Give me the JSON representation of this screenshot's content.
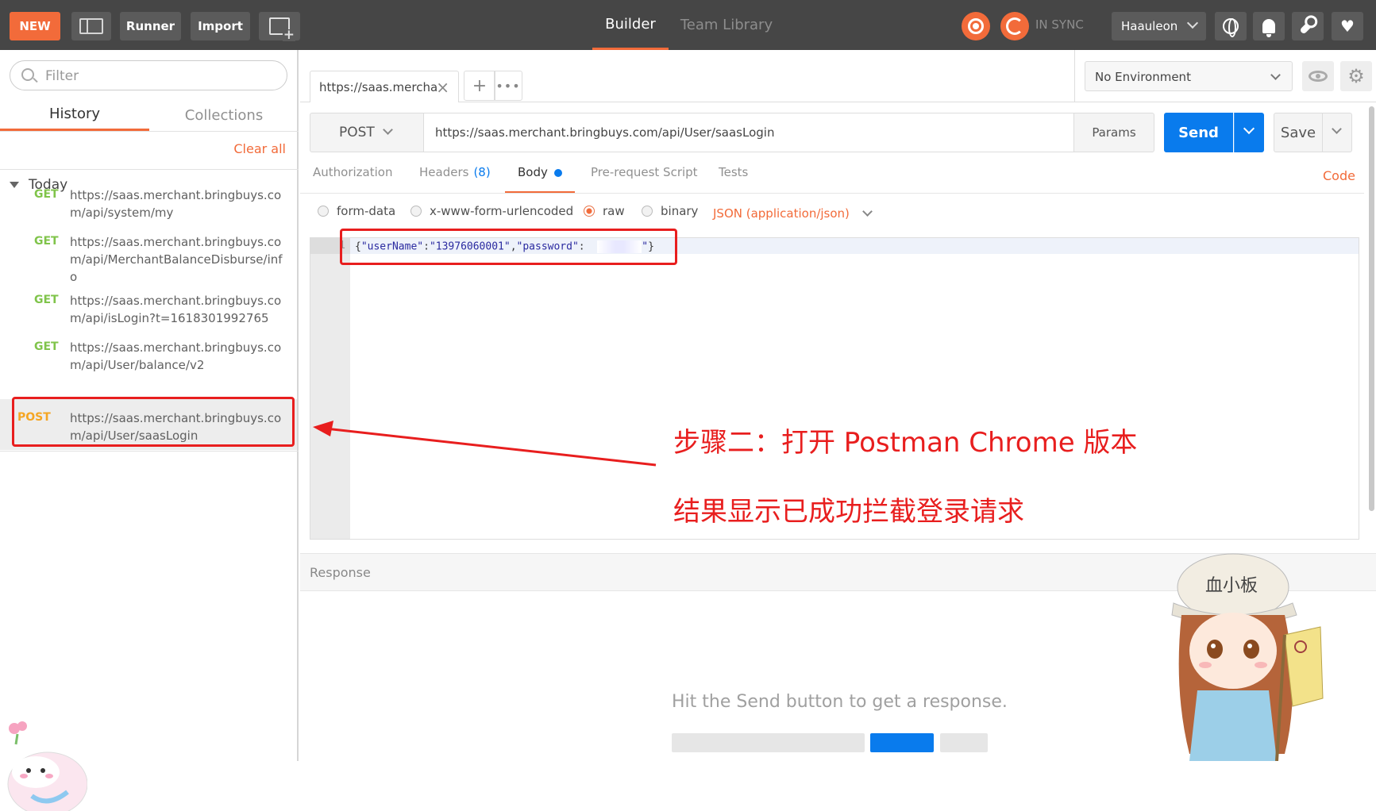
{
  "topbar": {
    "new_label": "NEW",
    "runner_label": "Runner",
    "import_label": "Import",
    "builder_label": "Builder",
    "team_library_label": "Team Library",
    "sync_label": "IN SYNC",
    "user_name": "Haauleon",
    "accent_color": "#f26b3a"
  },
  "sidebar": {
    "filter_placeholder": "Filter",
    "tabs": [
      "History",
      "Collections"
    ],
    "clear_all_label": "Clear all",
    "group_label": "Today",
    "history": [
      {
        "method": "GET",
        "url": "https://saas.merchant.bringbuys.com/api/system/my"
      },
      {
        "method": "GET",
        "url": "https://saas.merchant.bringbuys.com/api/MerchantBalanceDisburse/info"
      },
      {
        "method": "GET",
        "url": "https://saas.merchant.bringbuys.com/api/isLogin?t=1618301992765"
      },
      {
        "method": "GET",
        "url": "https://saas.merchant.bringbuys.com/api/User/balance/v2"
      },
      {
        "method": "POST",
        "url": "https://saas.merchant.bringbuys.com/api/User/saasLogin"
      }
    ]
  },
  "request_tab": {
    "title": "https://saas.mercha",
    "close_icon": "×",
    "add_icon": "+",
    "more_icon": "•••"
  },
  "environment": {
    "selected": "No Environment"
  },
  "request": {
    "method": "POST",
    "url": "https://saas.merchant.bringbuys.com/api/User/saasLogin",
    "params_label": "Params",
    "send_label": "Send",
    "save_label": "Save",
    "send_color": "#097bed"
  },
  "subtabs": {
    "authorization": "Authorization",
    "headers": "Headers",
    "headers_count": "(8)",
    "body": "Body",
    "prerequest": "Pre-request Script",
    "tests": "Tests",
    "code_link": "Code"
  },
  "body_types": {
    "form_data": "form-data",
    "urlencoded": "x-www-form-urlencoded",
    "raw": "raw",
    "binary": "binary",
    "selected": "raw",
    "content_type": "JSON (application/json)"
  },
  "editor": {
    "line_number": "1",
    "code": {
      "open": "{",
      "key1": "\"userName\"",
      "colon1": ":",
      "val1": "\"13976060001\"",
      "comma": ",",
      "key2": "\"password\"",
      "colon2": ":",
      "val2_open": "\"",
      "val2_close": "\"",
      "close": "}"
    }
  },
  "response": {
    "header_label": "Response",
    "hint": "Hit the Send button to get a response."
  },
  "annotation": {
    "line1": "步骤二：打开 Postman Chrome 版本",
    "line2": "结果显示已成功拦截登录请求",
    "color": "#e81e1e",
    "mascot_text": "血小板"
  }
}
